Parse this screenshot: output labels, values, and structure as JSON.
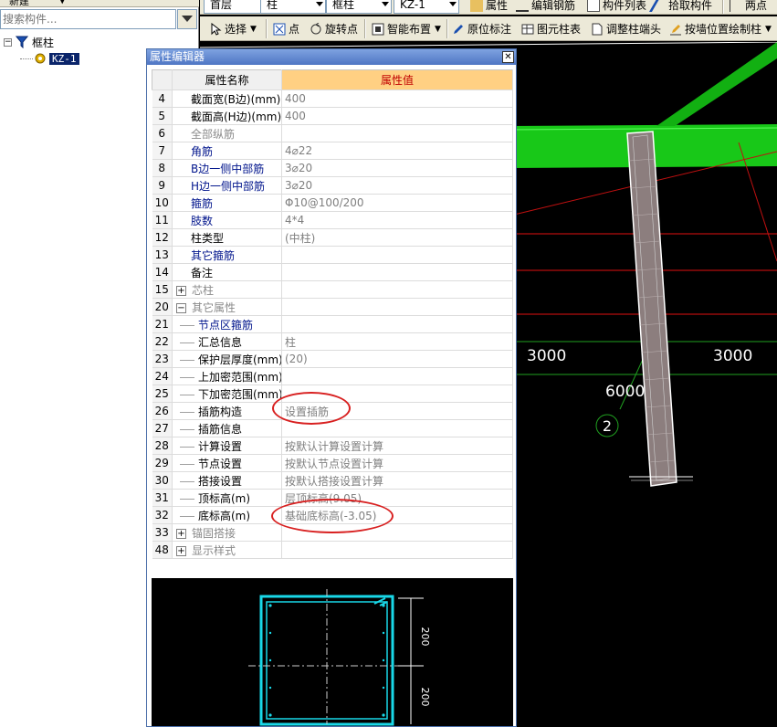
{
  "left_panel": {
    "toolbar_items": [
      "新建",
      "▼"
    ],
    "search_placeholder": "搜索构件...",
    "tree": {
      "root_label": "框柱",
      "root_expander": "−",
      "child_label": "KZ-1"
    }
  },
  "toolbar1": {
    "floor": "首层",
    "category": "柱",
    "type": "框柱",
    "component": "KZ-1",
    "buttons": [
      "属性",
      "编辑钢筋",
      "构件列表",
      "拾取构件",
      "两点"
    ]
  },
  "toolbar2": {
    "buttons": [
      "选择",
      "点",
      "旋转点",
      "智能布置",
      "原位标注",
      "图元柱表",
      "调整柱端头",
      "按墙位置绘制柱"
    ]
  },
  "viewport": {
    "dimension_left": "3000",
    "dimension_right": "3000",
    "dimension_diag": "6000",
    "axis_label": "2",
    "colors": {
      "beam": "#1ec81e",
      "axis_red": "#e01010",
      "axis_green": "#20a020",
      "column": "#8c7e7e"
    }
  },
  "property_editor": {
    "title": "属性编辑器",
    "close": "✕",
    "header": {
      "name": "属性名称",
      "value": "属性值"
    },
    "rows": [
      {
        "num": "4",
        "name": "截面宽(B边)(mm)",
        "value": "400",
        "style": "black",
        "prefix": "none"
      },
      {
        "num": "5",
        "name": "截面高(H边)(mm)",
        "value": "400",
        "style": "black",
        "prefix": "none"
      },
      {
        "num": "6",
        "name": "全部纵筋",
        "value": "",
        "style": "gray",
        "prefix": "none"
      },
      {
        "num": "7",
        "name": "角筋",
        "value": "4⌀22",
        "style": "blue",
        "prefix": "none"
      },
      {
        "num": "8",
        "name": "B边一侧中部筋",
        "value": "3⌀20",
        "style": "blue",
        "prefix": "none"
      },
      {
        "num": "9",
        "name": "H边一侧中部筋",
        "value": "3⌀20",
        "style": "blue",
        "prefix": "none"
      },
      {
        "num": "10",
        "name": "箍筋",
        "value": "Φ10@100/200",
        "style": "blue",
        "prefix": "none"
      },
      {
        "num": "11",
        "name": "肢数",
        "value": "4*4",
        "style": "blue",
        "prefix": "none"
      },
      {
        "num": "12",
        "name": "柱类型",
        "value": "(中柱)",
        "style": "black",
        "prefix": "none"
      },
      {
        "num": "13",
        "name": "其它箍筋",
        "value": "",
        "style": "blue",
        "prefix": "none"
      },
      {
        "num": "14",
        "name": "备注",
        "value": "",
        "style": "black",
        "prefix": "none"
      },
      {
        "num": "15",
        "name": "芯柱",
        "value": "",
        "style": "gray",
        "prefix": "plus"
      },
      {
        "num": "20",
        "name": "其它属性",
        "value": "",
        "style": "gray",
        "prefix": "minus"
      },
      {
        "num": "21",
        "name": "节点区箍筋",
        "value": "",
        "style": "blue",
        "prefix": "line"
      },
      {
        "num": "22",
        "name": "汇总信息",
        "value": "柱",
        "style": "black",
        "prefix": "line"
      },
      {
        "num": "23",
        "name": "保护层厚度(mm)",
        "value": "(20)",
        "style": "black",
        "prefix": "line"
      },
      {
        "num": "24",
        "name": "上加密范围(mm)",
        "value": "",
        "style": "black",
        "prefix": "line"
      },
      {
        "num": "25",
        "name": "下加密范围(mm)",
        "value": "",
        "style": "black",
        "prefix": "line"
      },
      {
        "num": "26",
        "name": "插筋构造",
        "value": "设置插筋",
        "style": "black",
        "prefix": "line"
      },
      {
        "num": "27",
        "name": "插筋信息",
        "value": "",
        "style": "black",
        "prefix": "line"
      },
      {
        "num": "28",
        "name": "计算设置",
        "value": "按默认计算设置计算",
        "style": "black",
        "prefix": "line"
      },
      {
        "num": "29",
        "name": "节点设置",
        "value": "按默认节点设置计算",
        "style": "black",
        "prefix": "line"
      },
      {
        "num": "30",
        "name": "搭接设置",
        "value": "按默认搭接设置计算",
        "style": "black",
        "prefix": "line"
      },
      {
        "num": "31",
        "name": "顶标高(m)",
        "value": "层顶标高(9.05)",
        "style": "black",
        "prefix": "line"
      },
      {
        "num": "32",
        "name": "底标高(m)",
        "value": "基础底标高(-3.05)",
        "style": "black",
        "prefix": "line"
      },
      {
        "num": "33",
        "name": "锚固搭接",
        "value": "",
        "style": "gray",
        "prefix": "plus"
      },
      {
        "num": "48",
        "name": "显示样式",
        "value": "",
        "style": "gray",
        "prefix": "plus"
      }
    ],
    "preview": {
      "dim_top": "200",
      "dim_bottom": "200",
      "stirrup_color": "#19d8e8"
    }
  }
}
